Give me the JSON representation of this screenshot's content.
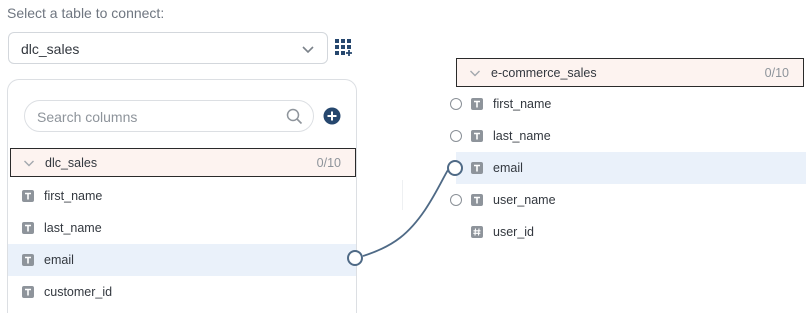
{
  "prompt": "Select a table to connect:",
  "table_select": {
    "value": "dlc_sales"
  },
  "search": {
    "placeholder": "Search columns"
  },
  "left_table": {
    "name": "dlc_sales",
    "count": "0/10",
    "columns": [
      {
        "name": "first_name",
        "type": "text-icon"
      },
      {
        "name": "last_name",
        "type": "text-icon"
      },
      {
        "name": "email",
        "type": "text-icon"
      },
      {
        "name": "customer_id",
        "type": "text-icon"
      }
    ]
  },
  "right_table": {
    "name": "e-commerce_sales",
    "count": "0/10",
    "columns": [
      {
        "name": "first_name",
        "type": "text-icon"
      },
      {
        "name": "last_name",
        "type": "text-icon"
      },
      {
        "name": "email",
        "type": "text-icon"
      },
      {
        "name": "user_name",
        "type": "text-icon"
      },
      {
        "name": "user_id",
        "type": "hash-icon"
      }
    ]
  },
  "mapping": {
    "from": "email",
    "to": "email"
  },
  "colors": {
    "accent": "#26476e",
    "link": "#4f6a86",
    "header_bg": "#fdf3f0",
    "active_row": "#eaf1fa"
  }
}
